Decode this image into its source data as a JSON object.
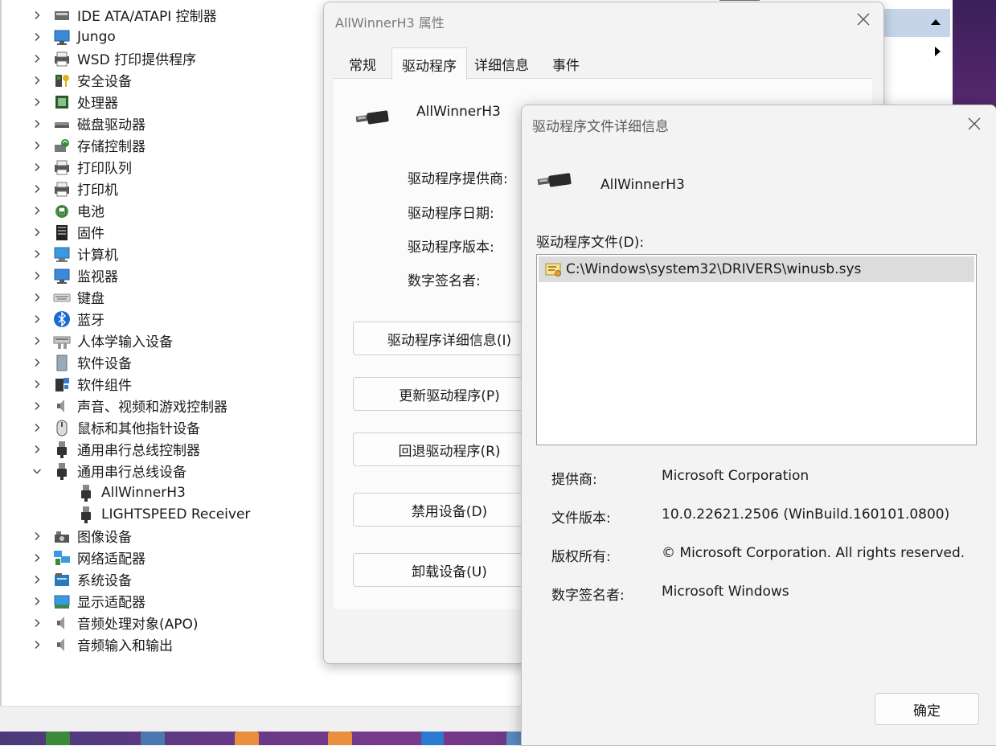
{
  "device_tree": {
    "categories": [
      {
        "label": "IDE ATA/ATAPI 控制器",
        "icon": "ide-controller-icon"
      },
      {
        "label": "Jungo",
        "icon": "monitor-icon"
      },
      {
        "label": "WSD 打印提供程序",
        "icon": "printer-icon"
      },
      {
        "label": "安全设备",
        "icon": "security-key-icon"
      },
      {
        "label": "处理器",
        "icon": "processor-icon"
      },
      {
        "label": "磁盘驱动器",
        "icon": "disk-drive-icon"
      },
      {
        "label": "存储控制器",
        "icon": "storage-controller-icon"
      },
      {
        "label": "打印队列",
        "icon": "printer-icon"
      },
      {
        "label": "打印机",
        "icon": "printer-icon"
      },
      {
        "label": "电池",
        "icon": "battery-icon"
      },
      {
        "label": "固件",
        "icon": "firmware-icon"
      },
      {
        "label": "计算机",
        "icon": "computer-icon"
      },
      {
        "label": "监视器",
        "icon": "monitor-icon"
      },
      {
        "label": "键盘",
        "icon": "keyboard-icon"
      },
      {
        "label": "蓝牙",
        "icon": "bluetooth-icon"
      },
      {
        "label": "人体学输入设备",
        "icon": "hid-icon"
      },
      {
        "label": "软件设备",
        "icon": "software-device-icon"
      },
      {
        "label": "软件组件",
        "icon": "software-component-icon"
      },
      {
        "label": "声音、视频和游戏控制器",
        "icon": "speaker-icon"
      },
      {
        "label": "鼠标和其他指针设备",
        "icon": "mouse-icon"
      },
      {
        "label": "通用串行总线控制器",
        "icon": "usb-plug-icon"
      },
      {
        "label": "通用串行总线设备",
        "icon": "usb-plug-icon",
        "expanded": true
      },
      {
        "label": "AllWinnerH3",
        "icon": "usb-plug-icon",
        "child": true
      },
      {
        "label": "LIGHTSPEED Receiver",
        "icon": "usb-plug-icon",
        "child": true
      },
      {
        "label": "图像设备",
        "icon": "camera-icon"
      },
      {
        "label": "网络适配器",
        "icon": "network-adapter-icon"
      },
      {
        "label": "系统设备",
        "icon": "system-device-icon"
      },
      {
        "label": "显示适配器",
        "icon": "display-adapter-icon"
      },
      {
        "label": "音频处理对象(APO)",
        "icon": "speaker-icon"
      },
      {
        "label": "音频输入和输出",
        "icon": "speaker-icon"
      }
    ]
  },
  "properties_dialog": {
    "title": "AllWinnerH3 属性",
    "tabs": [
      "常规",
      "驱动程序",
      "详细信息",
      "事件"
    ],
    "active_tab": "驱动程序",
    "device_name": "AllWinnerH3",
    "labels": [
      "驱动程序提供商:",
      "驱动程序日期:",
      "驱动程序版本:",
      "数字签名者:"
    ],
    "buttons": [
      "驱动程序详细信息(I)",
      "更新驱动程序(P)",
      "回退驱动程序(R)",
      "禁用设备(D)",
      "卸载设备(U)"
    ]
  },
  "driver_file_dialog": {
    "title": "驱动程序文件详细信息",
    "device_name": "AllWinnerH3",
    "files_label": "驱动程序文件(D):",
    "files": [
      "C:\\Windows\\system32\\DRIVERS\\winusb.sys"
    ],
    "info": [
      {
        "label": "提供商:",
        "value": "Microsoft Corporation"
      },
      {
        "label": "文件版本:",
        "value": "10.0.22621.2506 (WinBuild.160101.0800)"
      },
      {
        "label": "版权所有:",
        "value": "© Microsoft Corporation. All rights reserved."
      },
      {
        "label": "数字签名者:",
        "value": "Microsoft Windows"
      }
    ],
    "ok_label": "确定"
  }
}
